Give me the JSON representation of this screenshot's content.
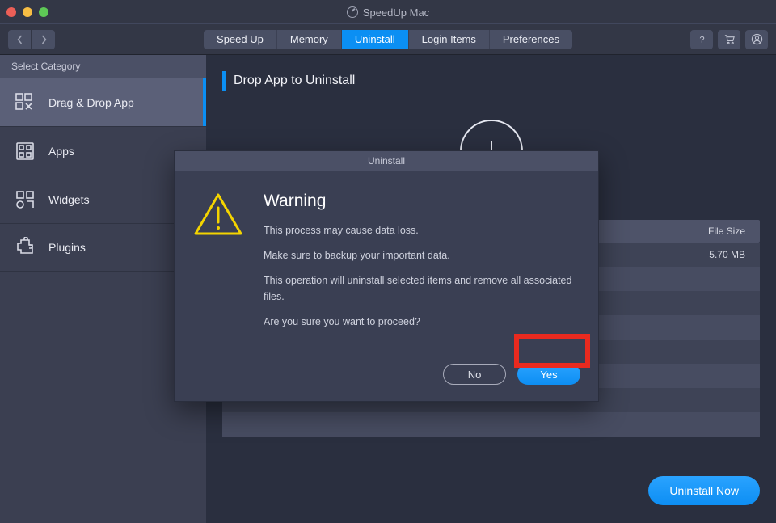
{
  "window": {
    "title": "SpeedUp Mac"
  },
  "toolbar": {
    "tabs": [
      "Speed Up",
      "Memory",
      "Uninstall",
      "Login Items",
      "Preferences"
    ],
    "active_tab_index": 2
  },
  "sidebar": {
    "header": "Select Category",
    "items": [
      {
        "label": "Drag & Drop App"
      },
      {
        "label": "Apps"
      },
      {
        "label": "Widgets"
      },
      {
        "label": "Plugins"
      }
    ],
    "active_index": 0
  },
  "main": {
    "title": "Drop App to Uninstall",
    "table": {
      "headers": {
        "size": "File Size"
      },
      "rows": [
        {
          "size": "5.70 MB"
        },
        {
          "size": ""
        },
        {
          "size": ""
        },
        {
          "size": ""
        },
        {
          "size": ""
        },
        {
          "size": ""
        },
        {
          "size": ""
        },
        {
          "size": ""
        }
      ]
    },
    "uninstall_button": "Uninstall Now"
  },
  "modal": {
    "title": "Uninstall",
    "heading": "Warning",
    "line1": "This process may cause data loss.",
    "line2": "Make sure to backup your important data.",
    "line3": "This operation will uninstall selected items and remove all associated files.",
    "line4": "Are you sure you want to proceed?",
    "no": "No",
    "yes": "Yes"
  }
}
